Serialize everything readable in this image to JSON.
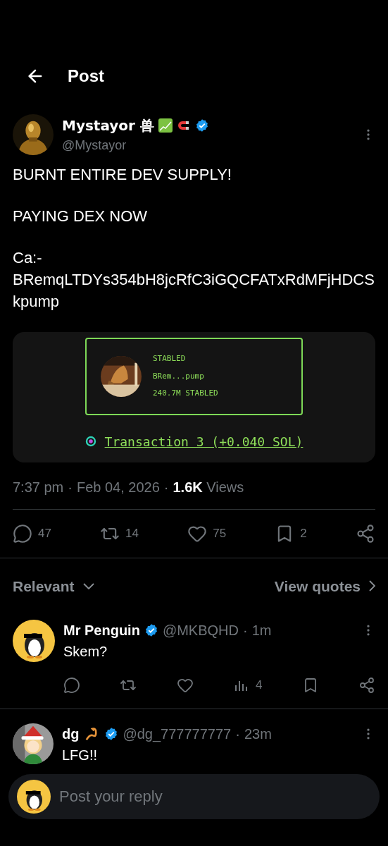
{
  "header": {
    "title": "Post"
  },
  "post": {
    "author": {
      "name": "Mystayor 兽",
      "handle": "@Mystayor",
      "verified": true
    },
    "paragraphs": [
      [
        "BURNT ENTIRE DEV SUPPLY!"
      ],
      [
        "PAYING DEX NOW"
      ],
      [
        "Ca:-",
        "BRemqLTDYs354bH8jcRfC3iGQCFATxRdMFjHDCSkpump"
      ]
    ],
    "card": {
      "token": "STABLED",
      "address": "BRem...pump",
      "amount": "240.7M STABLED",
      "link": "Transaction 3 (+0.040 SOL)"
    },
    "time": "7:37 pm",
    "separator": "·",
    "date": "Feb 04, 2026",
    "separator_2": "·",
    "views_count": "1.6K",
    "views_label": "Views",
    "actions": [
      {
        "kind": "reply",
        "count": "47"
      },
      {
        "kind": "repost",
        "count": "14"
      },
      {
        "kind": "like",
        "count": "75"
      },
      {
        "kind": "bookmark",
        "count": "2"
      },
      {
        "kind": "share"
      }
    ]
  },
  "sort": {
    "label": "Relevant",
    "quotes": "View quotes"
  },
  "replies": [
    {
      "name": "Mr Penguin",
      "verified": true,
      "handle": "@MKBQHD",
      "separator": "·",
      "time": "1m",
      "text": "Skem?",
      "kind": "penguin",
      "actions": [
        {
          "kind": "reply"
        },
        {
          "kind": "repost"
        },
        {
          "kind": "like"
        },
        {
          "kind": "views",
          "count": "4"
        },
        {
          "kind": "bookmark"
        },
        {
          "kind": "share"
        }
      ]
    },
    {
      "name": "dg",
      "verified": true,
      "handle": "@dg_777777777",
      "separator": "·",
      "time": "23m",
      "text": "LFG!!",
      "kind": "picture"
    }
  ],
  "reply_box": {
    "placeholder": "Post your reply"
  }
}
